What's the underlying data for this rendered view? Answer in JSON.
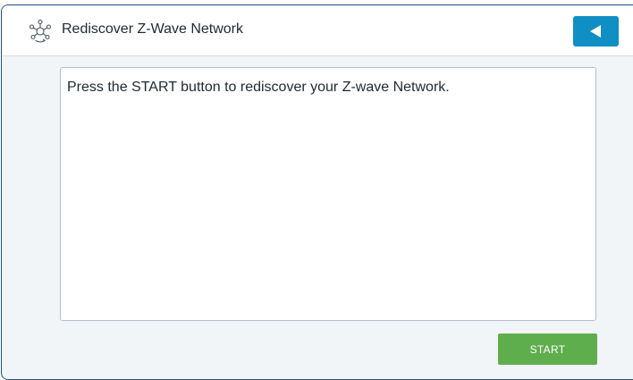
{
  "header": {
    "icon": "zwave-network-icon",
    "title": "Rediscover Z-Wave Network",
    "back_icon": "back-arrow-icon"
  },
  "main": {
    "message": "Press the START button to rediscover your Z-wave Network."
  },
  "actions": {
    "start_label": "START"
  },
  "colors": {
    "accent": "#0f8fc3",
    "start_button": "#5fae4d",
    "panel_background": "#f2f5f8",
    "window_border": "#1f4f7a"
  }
}
